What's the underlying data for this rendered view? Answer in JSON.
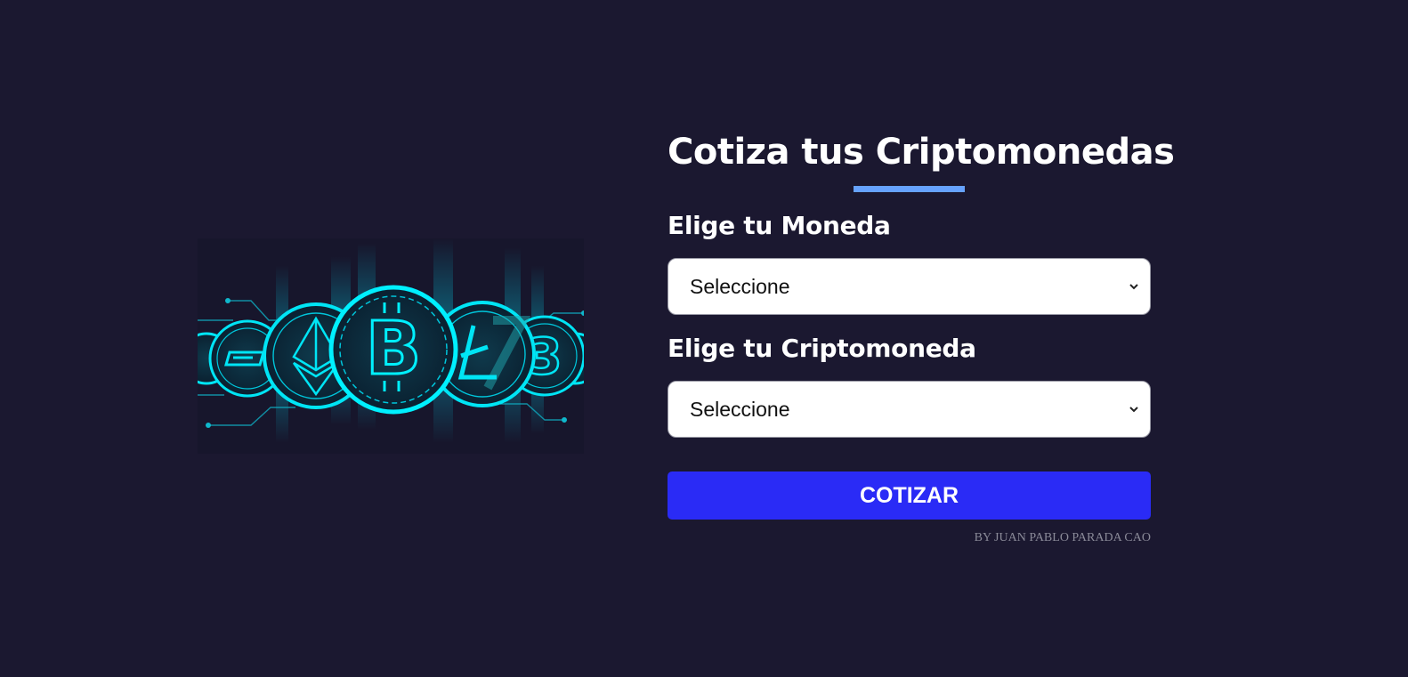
{
  "colors": {
    "background": "#1b1830",
    "accent_underline": "#66a2fe",
    "button": "#2a2bf6",
    "coin_glow": "#00e5f5"
  },
  "hero": {
    "image_icon": "crypto-coins-illustration"
  },
  "form": {
    "title": "Cotiza tus Criptomonedas",
    "moneda": {
      "label": "Elige tu Moneda",
      "value": "Seleccione"
    },
    "cripto": {
      "label": "Elige tu Criptomoneda",
      "value": "Seleccione"
    },
    "submit_label": "COTIZAR",
    "credit": "BY JUAN PABLO PARADA CAO"
  }
}
